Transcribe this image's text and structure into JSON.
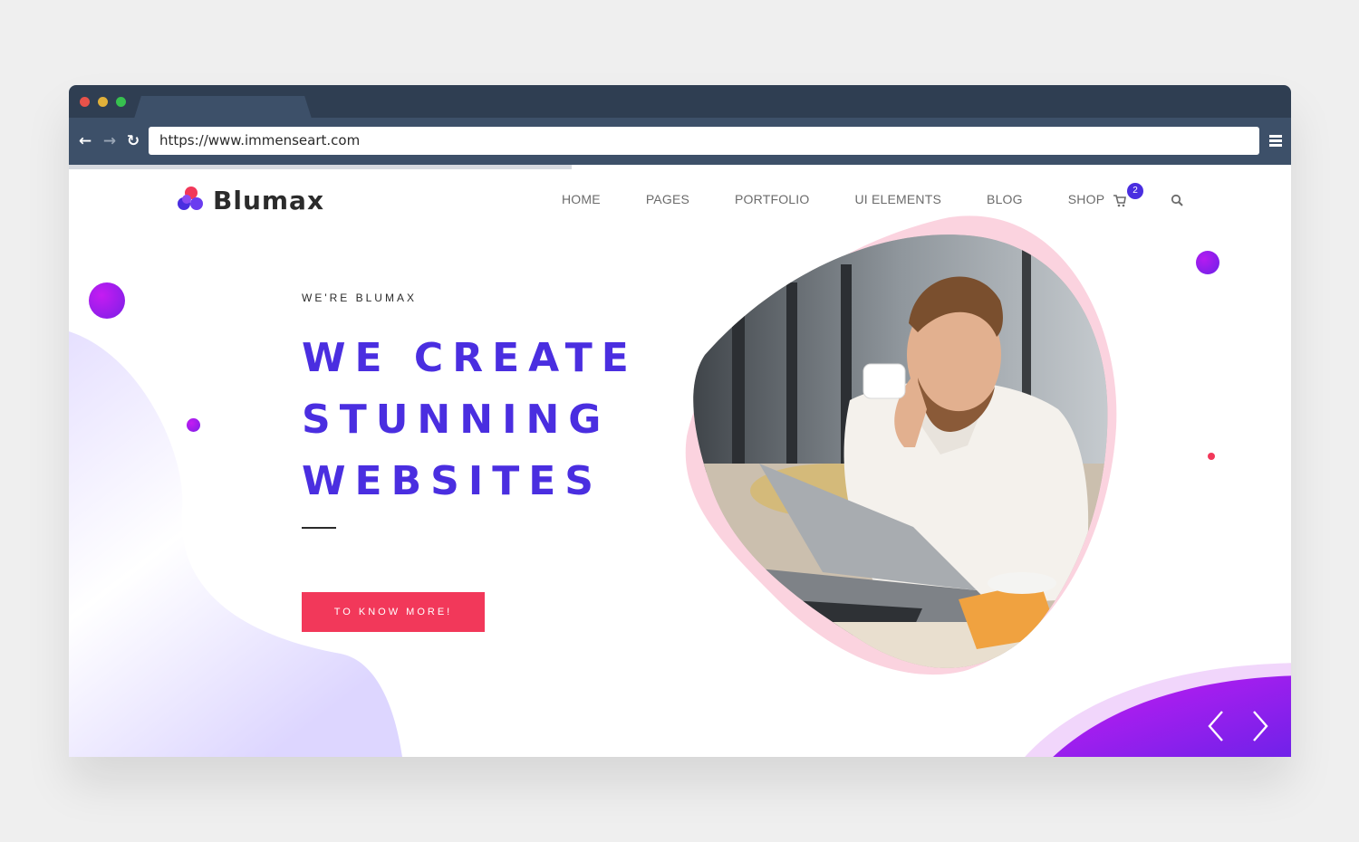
{
  "browser": {
    "url": "https://www.immenseart.com"
  },
  "site": {
    "brand": "Blumax",
    "nav": [
      "HOME",
      "PAGES",
      "PORTFOLIO",
      "UI ELEMENTS",
      "BLOG",
      "SHOP"
    ],
    "cart_count": "2"
  },
  "hero": {
    "eyebrow": "WE'RE BLUMAX",
    "headline": [
      "WE CREATE",
      "STUNNING",
      "WEBSITES"
    ],
    "cta": "TO KNOW MORE!"
  },
  "icons": {
    "back": "arrow-left-icon",
    "forward": "arrow-right-icon",
    "reload": "reload-icon",
    "menu": "hamburger-icon",
    "cart": "cart-icon",
    "search": "search-icon",
    "prev": "chevron-left-icon",
    "next": "chevron-right-icon"
  },
  "colors": {
    "accent": "#4a2ee0",
    "cta": "#f2385a",
    "chrome": "#2f3e52",
    "toolbar": "#3d5069",
    "magenta": "#c51cf2"
  }
}
